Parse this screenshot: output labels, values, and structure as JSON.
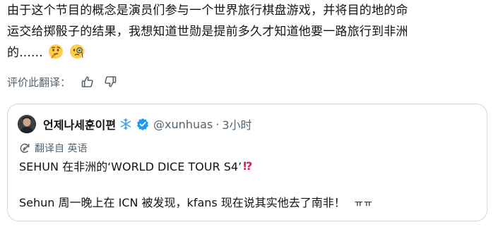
{
  "post": {
    "line1": "由于这个节目的概念是演员们参与一个世界旅行棋盘游戏，并将目的地的命",
    "line2": "运交给掷骰子的结果，我想知道世勋是提前多久才知道他要一路旅行到非洲",
    "line3": "的......",
    "emojis": [
      "thinking-face",
      "face-with-monocle"
    ]
  },
  "rate": {
    "label": "评价此翻译："
  },
  "quote": {
    "name": "언제나세훈이편",
    "handle": "@xunhuas",
    "dot": "·",
    "time": "3小时",
    "translated_label": "翻译自 英语",
    "line1": "SEHUN 在非洲的‘WORLD DICE TOUR S4’",
    "line1_emoji": "⁉",
    "line2": "Sehun 周一晚上在 ICN 被发现，kfans 现在说其实他去了南非！",
    "line2_suffix": "ㅠㅠ"
  },
  "colors": {
    "text": "#0f1419",
    "muted": "#536471",
    "border": "#cfd9de",
    "verified": "#1d9bf0",
    "snowflake": "#4aa3df",
    "exclamation": "#d8204a"
  }
}
